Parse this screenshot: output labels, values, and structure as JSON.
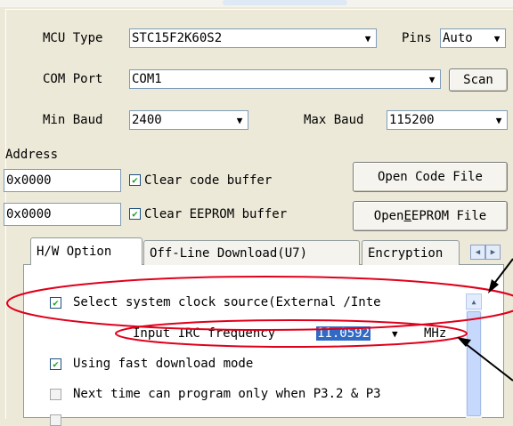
{
  "mcu": {
    "type_label": "MCU Type",
    "type_value": "STC15F2K60S2",
    "pins_label": "Pins",
    "pins_value": "Auto"
  },
  "com": {
    "label": "COM Port",
    "value": "COM1",
    "scan_label": "Scan"
  },
  "baud": {
    "min_label": "Min Baud",
    "min_value": "2400",
    "max_label": "Max Baud",
    "max_value": "115200"
  },
  "address": {
    "label": "Address",
    "code_addr": "0x0000",
    "clear_code_label": "Clear code buffer",
    "open_code_label": "Open Code File",
    "eeprom_addr": "0x0000",
    "clear_eeprom_label": "Clear EEPROM buffer",
    "open_eeprom_pre": "Open ",
    "open_eeprom_key": "E",
    "open_eeprom_post": "EPROM File"
  },
  "tabs": [
    "H/W Option",
    "Off-Line Download(U7)",
    "Encryption"
  ],
  "options": {
    "clock_source_label": "Select system clock source(External /Inte",
    "irc_label": "Input IRC frequency",
    "irc_value": "11.0592",
    "irc_unit": "MHz",
    "fast_download_label": "Using fast download mode",
    "next_time_label": "Next time can program only when P3.2 & P3"
  },
  "colors": {
    "annotation": "#e0001b",
    "selection": "#316ac5",
    "check": "#21a121"
  }
}
